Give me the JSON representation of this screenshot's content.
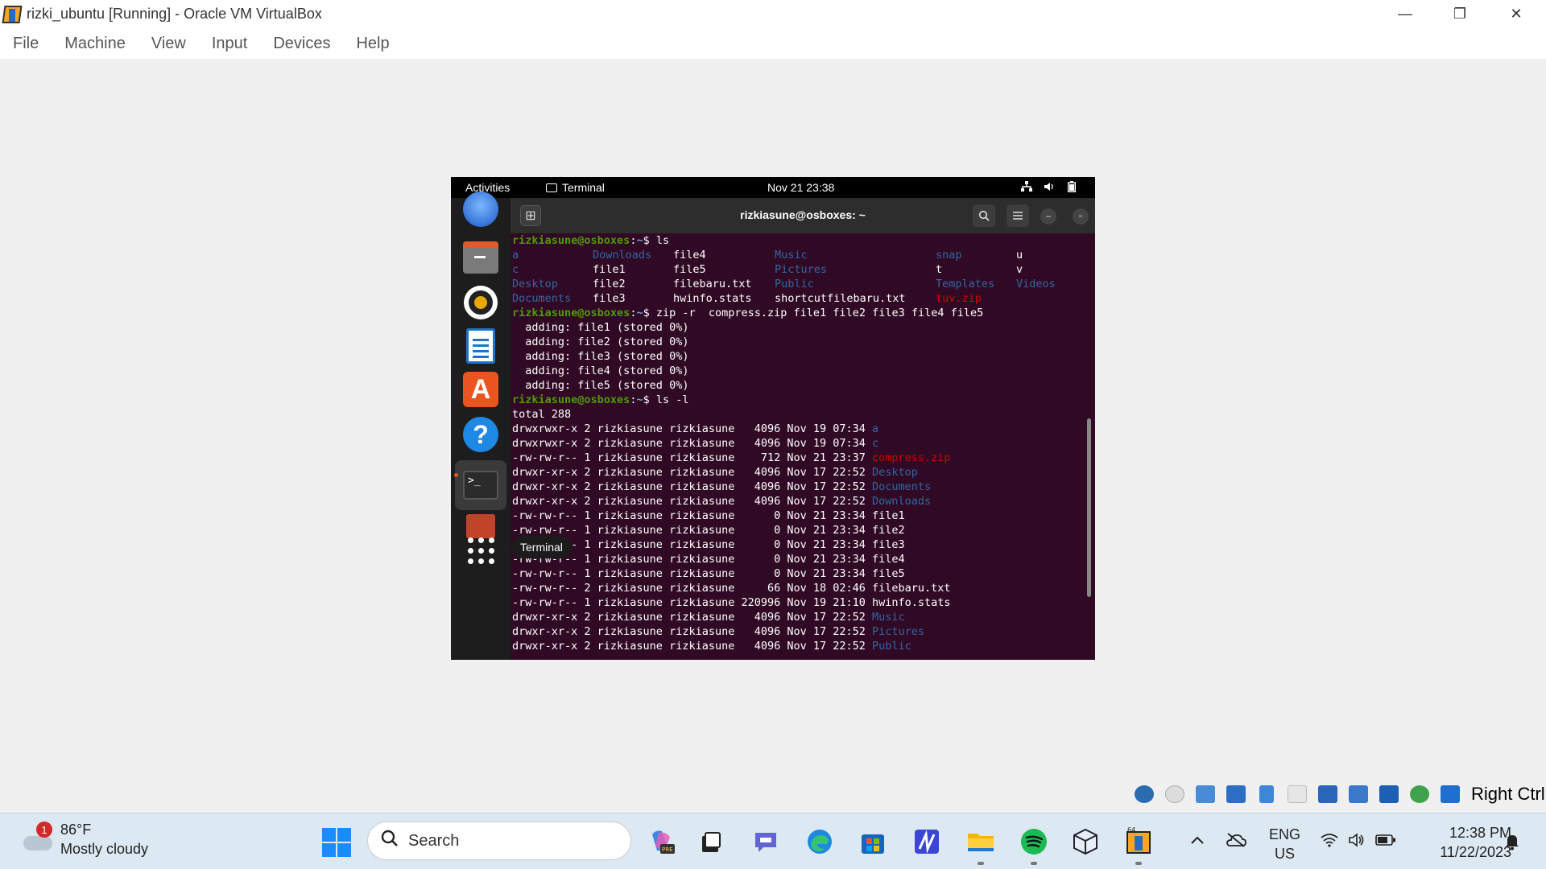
{
  "window": {
    "title": "rizki_ubuntu [Running] - Oracle VM VirtualBox",
    "minimize": "—",
    "maximize": "❐",
    "close": "✕"
  },
  "menubar": [
    "File",
    "Machine",
    "View",
    "Input",
    "Devices",
    "Help"
  ],
  "guest": {
    "topbar": {
      "activities": "Activities",
      "app": "Terminal",
      "clock": "Nov 21  23:38"
    },
    "dock_tooltip": "Terminal",
    "terminal": {
      "title": "rizkiasune@osboxes: ~",
      "lines": [
        {
          "type": "prompt",
          "user": "rizkiasune@osboxes",
          "path": "~",
          "cmd": " ls"
        },
        {
          "type": "cols",
          "cells": [
            {
              "t": "a",
              "c": "dir"
            },
            {
              "t": "Downloads",
              "c": "dir"
            },
            {
              "t": "file4",
              "c": ""
            },
            {
              "t": "Music",
              "c": "dir"
            },
            {
              "t": "snap",
              "c": "dir"
            },
            {
              "t": "u",
              "c": ""
            }
          ]
        },
        {
          "type": "cols",
          "cells": [
            {
              "t": "c",
              "c": "dir"
            },
            {
              "t": "file1",
              "c": ""
            },
            {
              "t": "file5",
              "c": ""
            },
            {
              "t": "Pictures",
              "c": "dir"
            },
            {
              "t": "t",
              "c": ""
            },
            {
              "t": "v",
              "c": ""
            }
          ]
        },
        {
          "type": "cols",
          "cells": [
            {
              "t": "Desktop",
              "c": "dir"
            },
            {
              "t": "file2",
              "c": ""
            },
            {
              "t": "filebaru.txt",
              "c": ""
            },
            {
              "t": "Public",
              "c": "dir"
            },
            {
              "t": "Templates",
              "c": "dir"
            },
            {
              "t": "Videos",
              "c": "dir"
            }
          ]
        },
        {
          "type": "cols",
          "cells": [
            {
              "t": "Documents",
              "c": "dir"
            },
            {
              "t": "file3",
              "c": ""
            },
            {
              "t": "hwinfo.stats",
              "c": ""
            },
            {
              "t": "shortcutfilebaru.txt",
              "c": ""
            },
            {
              "t": "tuv.zip",
              "c": "zip"
            },
            {
              "t": "",
              "c": ""
            }
          ]
        },
        {
          "type": "prompt",
          "user": "rizkiasune@osboxes",
          "path": "~",
          "cmd": " zip -r  compress.zip file1 file2 file3 file4 file5"
        },
        {
          "type": "text",
          "text": "  adding: file1 (stored 0%)"
        },
        {
          "type": "text",
          "text": "  adding: file2 (stored 0%)"
        },
        {
          "type": "text",
          "text": "  adding: file3 (stored 0%)"
        },
        {
          "type": "text",
          "text": "  adding: file4 (stored 0%)"
        },
        {
          "type": "text",
          "text": "  adding: file5 (stored 0%)"
        },
        {
          "type": "prompt",
          "user": "rizkiasune@osboxes",
          "path": "~",
          "cmd": " ls -l"
        },
        {
          "type": "text",
          "text": "total 288"
        },
        {
          "type": "ll",
          "meta": "drwxrwxr-x 2 rizkiasune rizkiasune   4096 Nov 19 07:34 ",
          "name": "a",
          "c": "dir"
        },
        {
          "type": "ll",
          "meta": "drwxrwxr-x 2 rizkiasune rizkiasune   4096 Nov 19 07:34 ",
          "name": "c",
          "c": "dir"
        },
        {
          "type": "ll",
          "meta": "-rw-rw-r-- 1 rizkiasune rizkiasune    712 Nov 21 23:37 ",
          "name": "compress.zip",
          "c": "zip"
        },
        {
          "type": "ll",
          "meta": "drwxr-xr-x 2 rizkiasune rizkiasune   4096 Nov 17 22:52 ",
          "name": "Desktop",
          "c": "dir"
        },
        {
          "type": "ll",
          "meta": "drwxr-xr-x 2 rizkiasune rizkiasune   4096 Nov 17 22:52 ",
          "name": "Documents",
          "c": "dir"
        },
        {
          "type": "ll",
          "meta": "drwxr-xr-x 2 rizkiasune rizkiasune   4096 Nov 17 22:52 ",
          "name": "Downloads",
          "c": "dir"
        },
        {
          "type": "ll",
          "meta": "-rw-rw-r-- 1 rizkiasune rizkiasune      0 Nov 21 23:34 ",
          "name": "file1",
          "c": ""
        },
        {
          "type": "ll",
          "meta": "-rw-rw-r-- 1 rizkiasune rizkiasune      0 Nov 21 23:34 ",
          "name": "file2",
          "c": ""
        },
        {
          "type": "ll",
          "meta": "-rw-rw-r-- 1 rizkiasune rizkiasune      0 Nov 21 23:34 ",
          "name": "file3",
          "c": ""
        },
        {
          "type": "ll",
          "meta": "-rw-rw-r-- 1 rizkiasune rizkiasune      0 Nov 21 23:34 ",
          "name": "file4",
          "c": ""
        },
        {
          "type": "ll",
          "meta": "-rw-rw-r-- 1 rizkiasune rizkiasune      0 Nov 21 23:34 ",
          "name": "file5",
          "c": ""
        },
        {
          "type": "ll",
          "meta": "-rw-rw-r-- 2 rizkiasune rizkiasune     66 Nov 18 02:46 ",
          "name": "filebaru.txt",
          "c": ""
        },
        {
          "type": "ll",
          "meta": "-rw-rw-r-- 1 rizkiasune rizkiasune 220996 Nov 19 21:10 ",
          "name": "hwinfo.stats",
          "c": ""
        },
        {
          "type": "ll",
          "meta": "drwxr-xr-x 2 rizkiasune rizkiasune   4096 Nov 17 22:52 ",
          "name": "Music",
          "c": "dir"
        },
        {
          "type": "ll",
          "meta": "drwxr-xr-x 2 rizkiasune rizkiasune   4096 Nov 17 22:52 ",
          "name": "Pictures",
          "c": "dir"
        },
        {
          "type": "ll",
          "meta": "drwxr-xr-x 2 rizkiasune rizkiasune   4096 Nov 17 22:52 ",
          "name": "Public",
          "c": "dir"
        }
      ]
    }
  },
  "statusbar": {
    "host_key": "Right Ctrl"
  },
  "taskbar": {
    "weather": {
      "badge": "1",
      "temp": "86°F",
      "desc": "Mostly cloudy"
    },
    "search_placeholder": "Search",
    "lang": {
      "line1": "ENG",
      "line2": "US"
    },
    "clock": {
      "time": "12:38 PM",
      "date": "11/22/2023"
    }
  },
  "colors": {
    "terminal_bg": "#300a24",
    "prompt_green": "#4e9a06",
    "path_blue": "#729fcf",
    "dir_blue": "#3465a4",
    "zip_red": "#cc0000"
  }
}
